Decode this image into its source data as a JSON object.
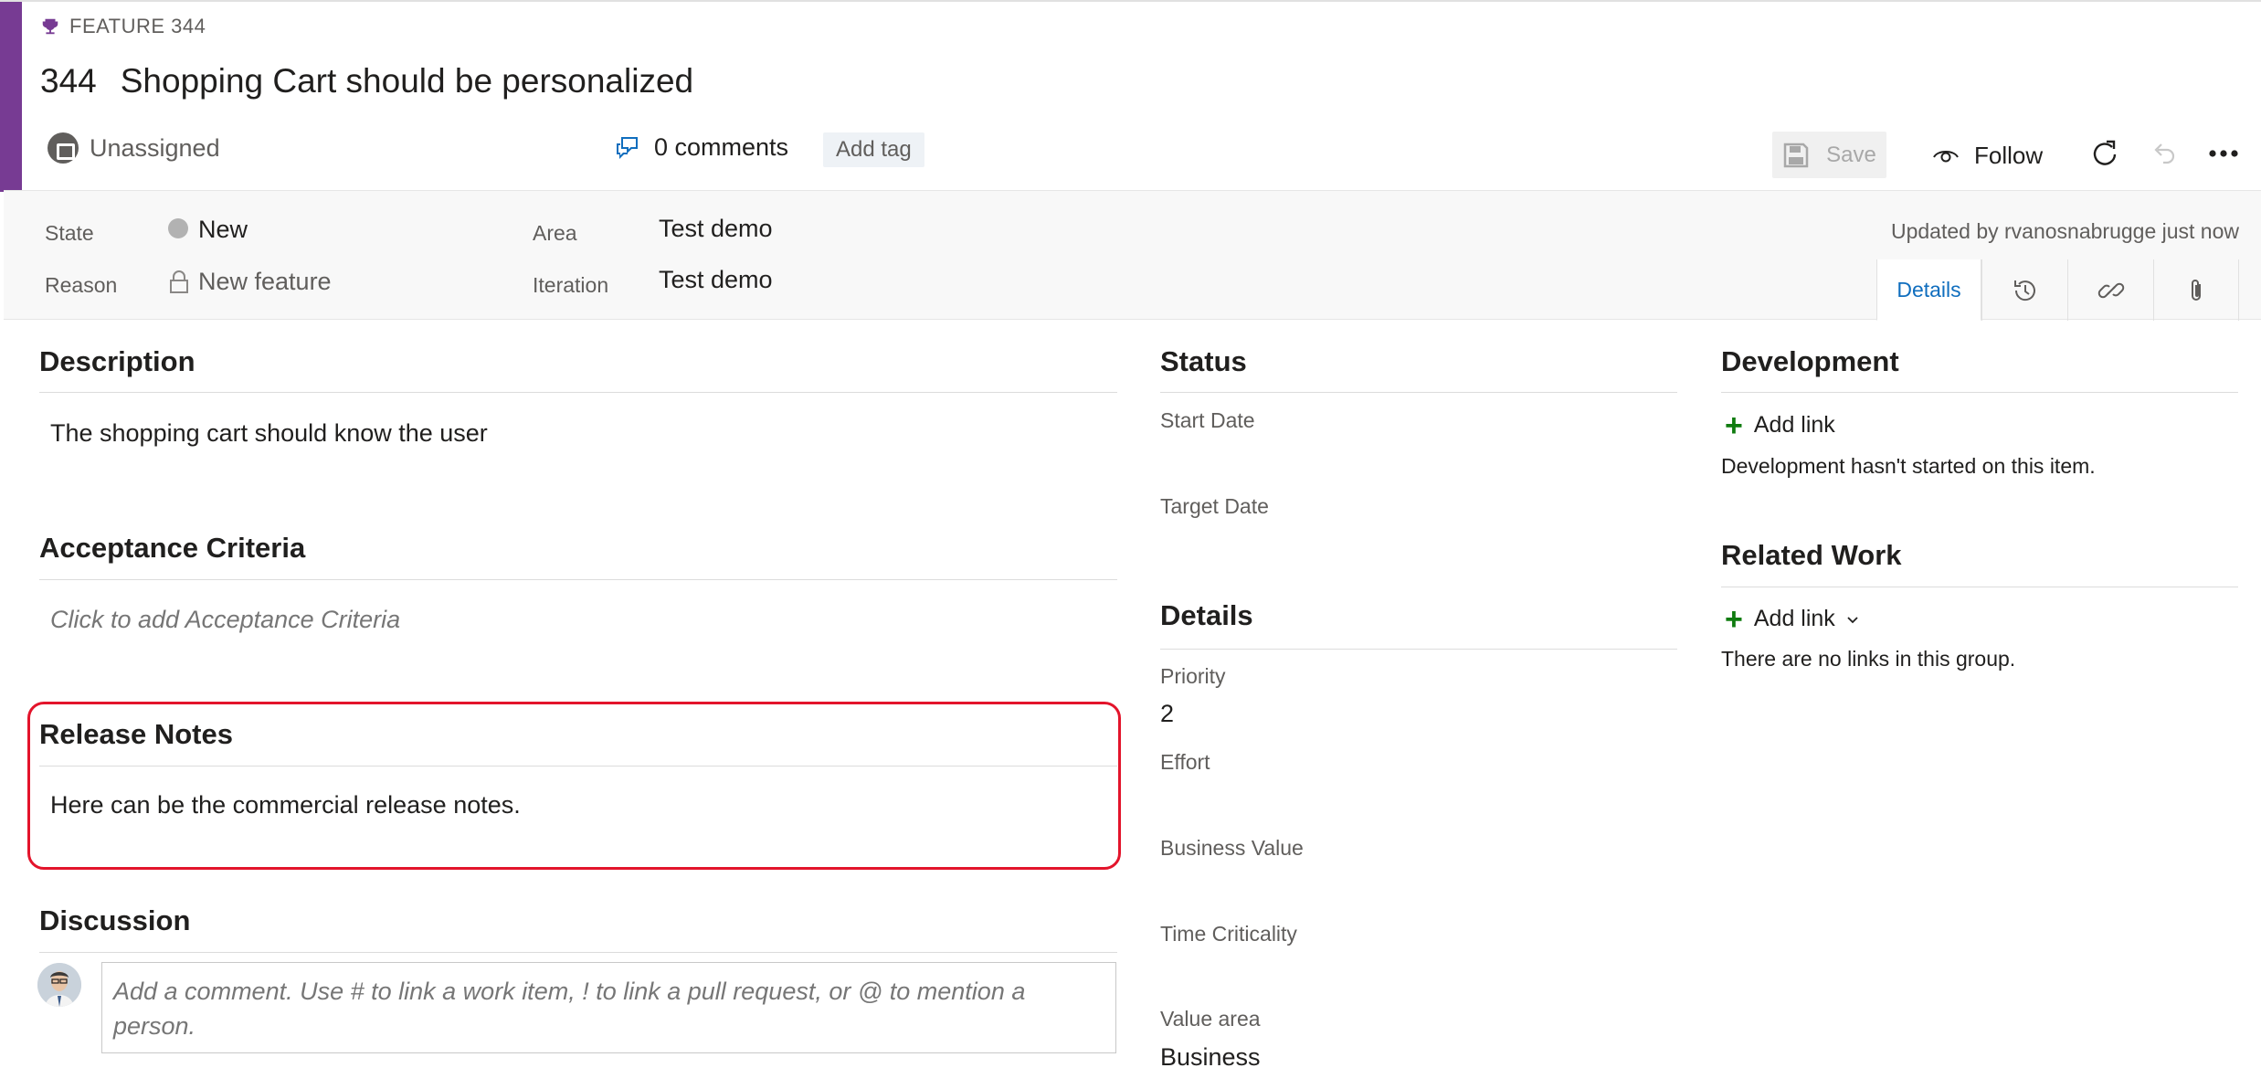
{
  "work_item": {
    "type_label": "FEATURE 344",
    "id": "344",
    "title": "Shopping Cart should be personalized",
    "accent_color": "#773b93"
  },
  "header": {
    "assigned": "Unassigned",
    "comments": "0 comments",
    "add_tag": "Add tag",
    "save": "Save",
    "follow": "Follow"
  },
  "fields": {
    "state_label": "State",
    "state_value": "New",
    "reason_label": "Reason",
    "reason_value": "New feature",
    "area_label": "Area",
    "area_value": "Test demo",
    "iteration_label": "Iteration",
    "iteration_value": "Test demo",
    "updated": "Updated by rvanosnabrugge just now"
  },
  "tabs": {
    "details": "Details"
  },
  "left": {
    "description_title": "Description",
    "description_text": "The shopping cart should know the user",
    "acceptance_title": "Acceptance Criteria",
    "acceptance_placeholder": "Click to add Acceptance Criteria",
    "release_title": "Release Notes",
    "release_text": "Here can be the commercial release notes.",
    "discussion_title": "Discussion",
    "comment_placeholder_line1": "Add a comment. Use # to link a work item, ! to link a pull request, or @ to mention a",
    "comment_placeholder_line2": "person."
  },
  "middle": {
    "status_title": "Status",
    "start_date_label": "Start Date",
    "target_date_label": "Target Date",
    "details_title": "Details",
    "priority_label": "Priority",
    "priority_value": "2",
    "effort_label": "Effort",
    "business_value_label": "Business Value",
    "time_criticality_label": "Time Criticality",
    "value_area_label": "Value area",
    "value_area_value": "Business"
  },
  "right": {
    "development_title": "Development",
    "dev_add_link": "Add link",
    "dev_empty": "Development hasn't started on this item.",
    "related_title": "Related Work",
    "related_add_link": "Add link",
    "related_empty": "There are no links in this group."
  },
  "icons": [
    "trophy-icon",
    "unassigned-avatar-icon",
    "comments-icon",
    "save-icon",
    "eye-icon",
    "refresh-icon",
    "undo-icon",
    "more-icon",
    "history-icon",
    "link-icon",
    "attachment-icon",
    "lock-icon",
    "plus-icon",
    "chevron-down-icon"
  ]
}
